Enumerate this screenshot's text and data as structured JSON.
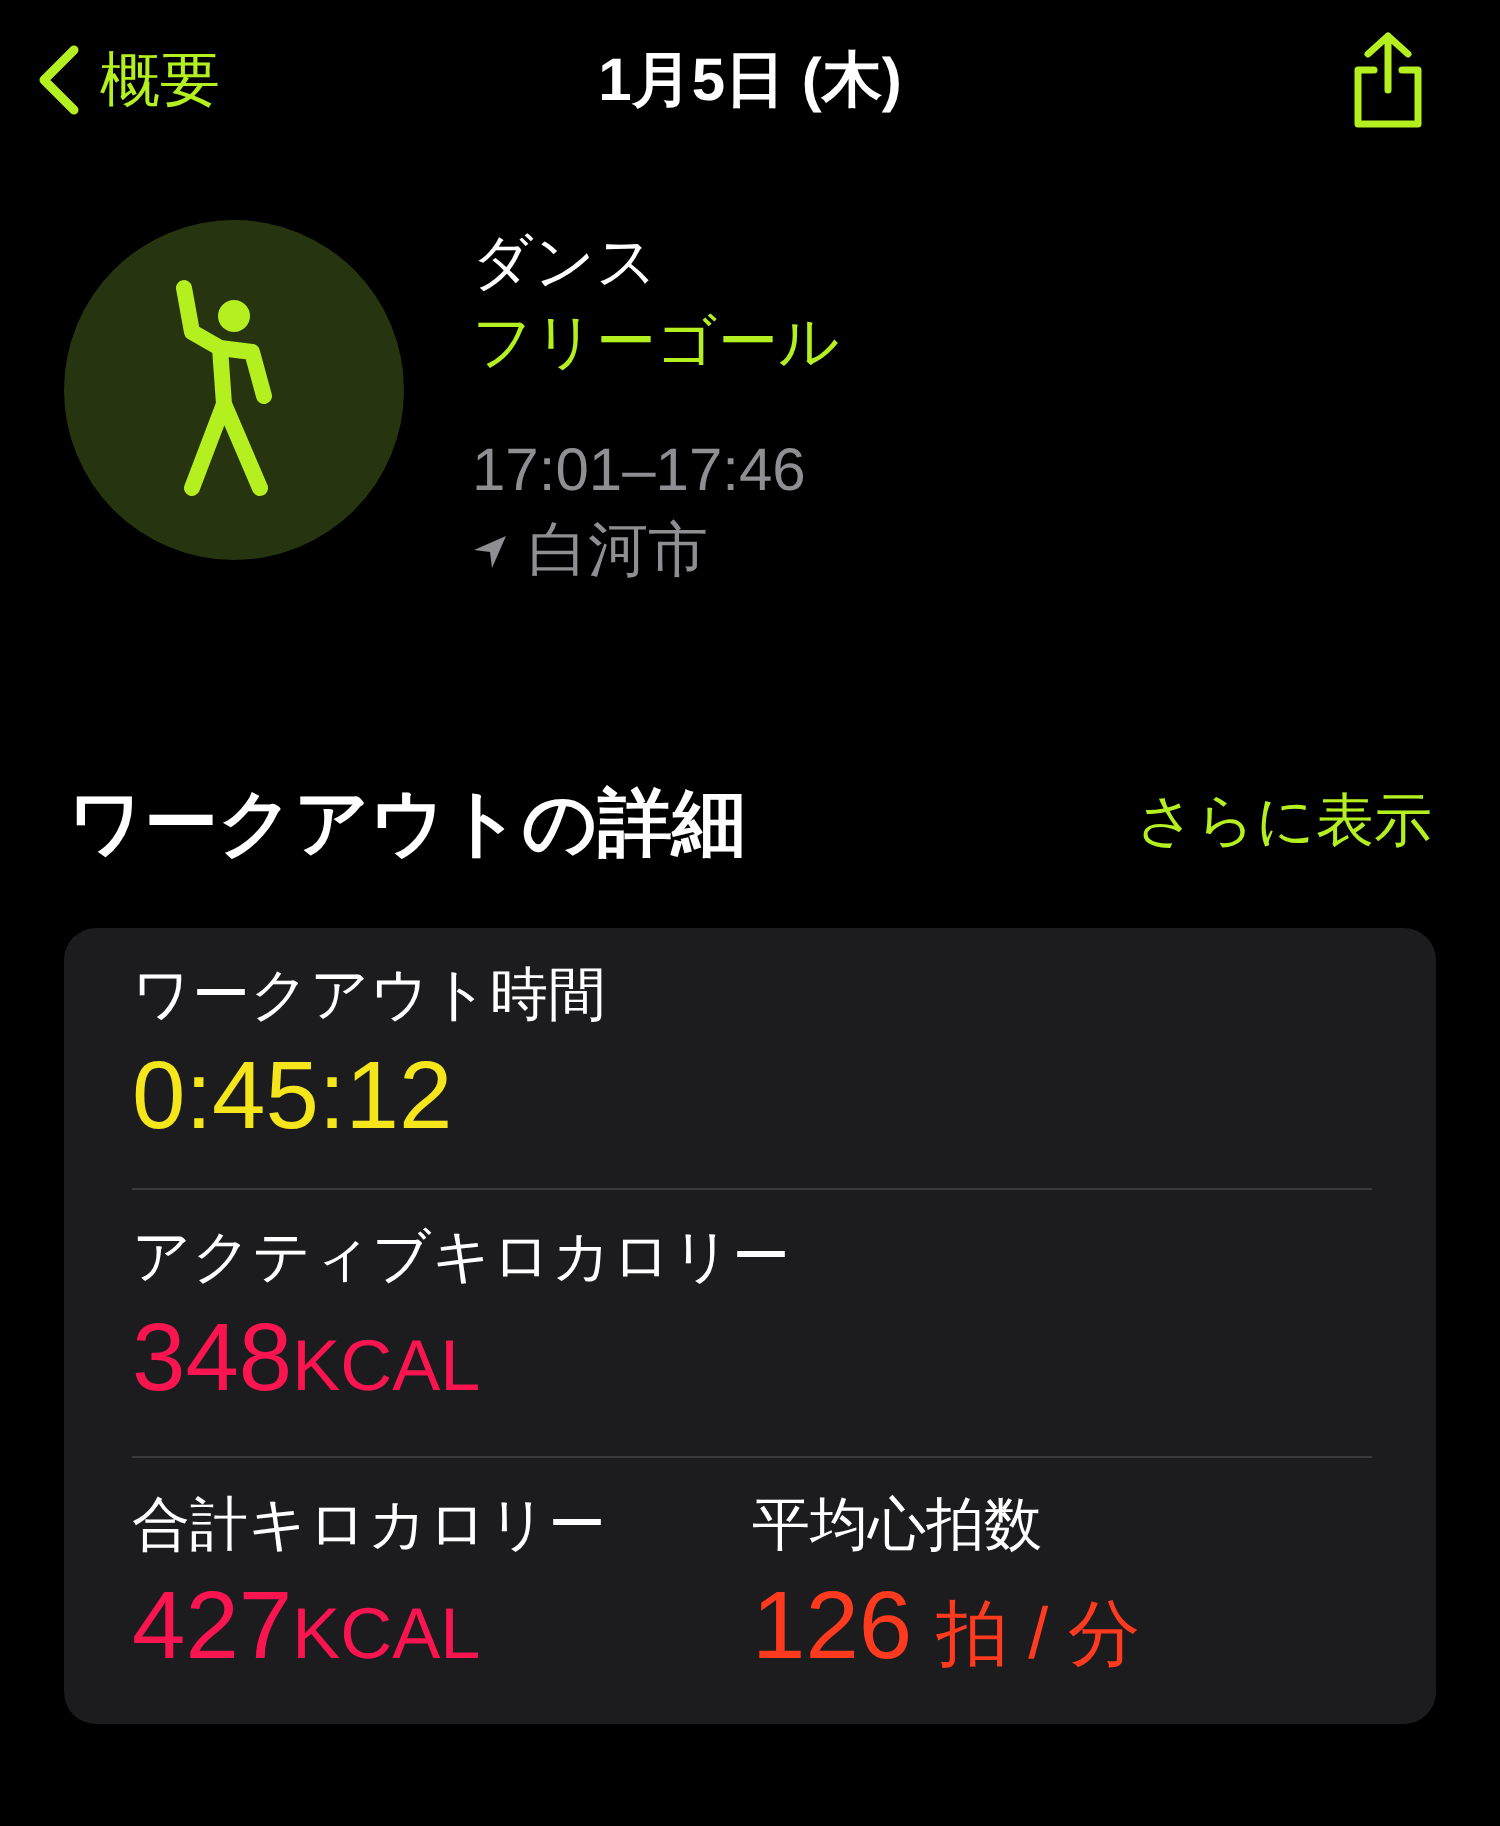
{
  "header": {
    "back_label": "概要",
    "title": "1月5日 (木)"
  },
  "workout": {
    "type": "ダンス",
    "goal": "フリーゴール",
    "time_range": "17:01–17:46",
    "location": "白河市"
  },
  "details": {
    "title": "ワークアウトの詳細",
    "more_link": "さらに表示",
    "rows": [
      [
        {
          "label": "ワークアウト時間",
          "value": "0:45:12",
          "color": "#f5e51b"
        }
      ],
      [
        {
          "label": "アクティブキロカロリー",
          "value": "348",
          "unit": "KCAL",
          "color": "#fa1551"
        }
      ],
      [
        {
          "label": "合計キロカロリー",
          "value": "427",
          "unit": "KCAL",
          "color": "#fa1551"
        },
        {
          "label": "平均心拍数",
          "value": "126",
          "unit": "拍 / 分",
          "color": "#ff3a1e"
        }
      ]
    ]
  }
}
